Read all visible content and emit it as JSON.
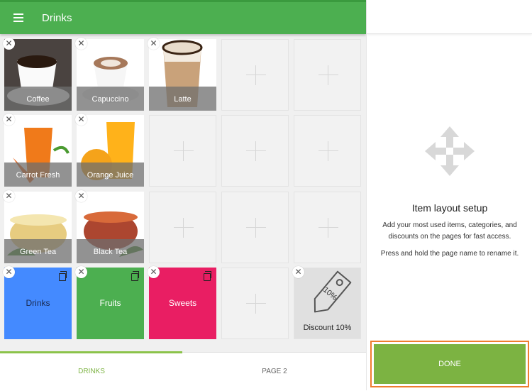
{
  "header": {
    "title": "Drinks",
    "menu_icon": "hamburger-icon"
  },
  "items": [
    {
      "label": "Coffee",
      "bg": "#4a4340"
    },
    {
      "label": "Capuccino",
      "bg": "#ffffff"
    },
    {
      "label": "Latte",
      "bg": "#ffffff"
    },
    {
      "label": "Carrot Fresh",
      "bg": "#ffffff"
    },
    {
      "label": "Orange Juice",
      "bg": "#ffffff"
    },
    {
      "label": "Green Tea",
      "bg": "#ffffff"
    },
    {
      "label": "Black Tea",
      "bg": "#ffffff"
    }
  ],
  "categories": [
    {
      "label": "Drinks",
      "color": "#448aff"
    },
    {
      "label": "Fruits",
      "color": "#4caf50"
    },
    {
      "label": "Sweets",
      "color": "#e91e63"
    }
  ],
  "discount": {
    "label": "Discount 10%",
    "tag_text": "10%"
  },
  "tabs": [
    {
      "label": "DRINKS",
      "active": true
    },
    {
      "label": "PAGE 2",
      "active": false
    }
  ],
  "panel": {
    "heading": "Item layout setup",
    "text1": "Add your most used items, categories, and discounts on the pages for fast access.",
    "text2": "Press and hold the page name to rename it.",
    "done": "DONE"
  },
  "colors": {
    "accent": "#4caf50",
    "done": "#7cb342",
    "highlight": "#ef7d2f"
  }
}
